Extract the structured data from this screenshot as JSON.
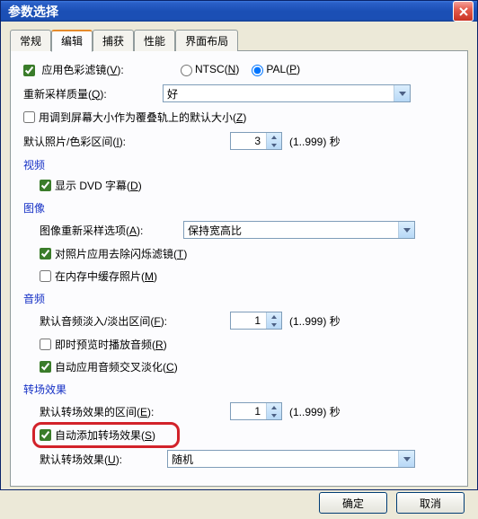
{
  "window": {
    "title": "参数选择"
  },
  "tabs": [
    "常规",
    "编辑",
    "捕获",
    "性能",
    "界面布局"
  ],
  "active_tab_index": 1,
  "content": {
    "apply_color_filter": "应用色彩滤镜",
    "apply_color_filter_key": "V",
    "ntsc": "NTSC",
    "ntsc_key": "N",
    "pal": "PAL",
    "pal_key": "P",
    "resample_quality": "重新采样质量",
    "resample_quality_key": "Q",
    "resample_value": "好",
    "resize_original": "用调到屏幕大小作为覆叠轨上的默认大小",
    "resize_original_key": "Z",
    "default_photo_interval": "默认照片/色彩区间",
    "default_photo_interval_key": "I",
    "default_photo_value": "3",
    "interval_hint": "(1..999) 秒",
    "video_title": "视频",
    "show_dvd_subtitle": "显示 DVD 字幕",
    "show_dvd_subtitle_key": "D",
    "image_title": "图像",
    "image_resample_option": "图像重新采样选项",
    "image_resample_option_key": "A",
    "image_resample_value": "保持宽高比",
    "deflicker": "对照片应用去除闪烁滤镜",
    "deflicker_key": "T",
    "cache_photos": "在内存中缓存照片",
    "cache_photos_key": "M",
    "audio_title": "音频",
    "audio_fade_interval": "默认音频淡入/淡出区间",
    "audio_fade_interval_key": "F",
    "audio_fade_value": "1",
    "instant_preview": "即时预览时播放音频",
    "instant_preview_key": "R",
    "auto_crossfade": "自动应用音频交叉淡化",
    "auto_crossfade_key": "C",
    "transition_title": "转场效果",
    "transition_interval": "默认转场效果的区间",
    "transition_interval_key": "E",
    "transition_interval_value": "1",
    "auto_add_transition": "自动添加转场效果",
    "auto_add_transition_key": "S",
    "default_transition": "默认转场效果",
    "default_transition_key": "U",
    "default_transition_value": "随机"
  },
  "buttons": {
    "ok": "确定",
    "cancel": "取消"
  }
}
